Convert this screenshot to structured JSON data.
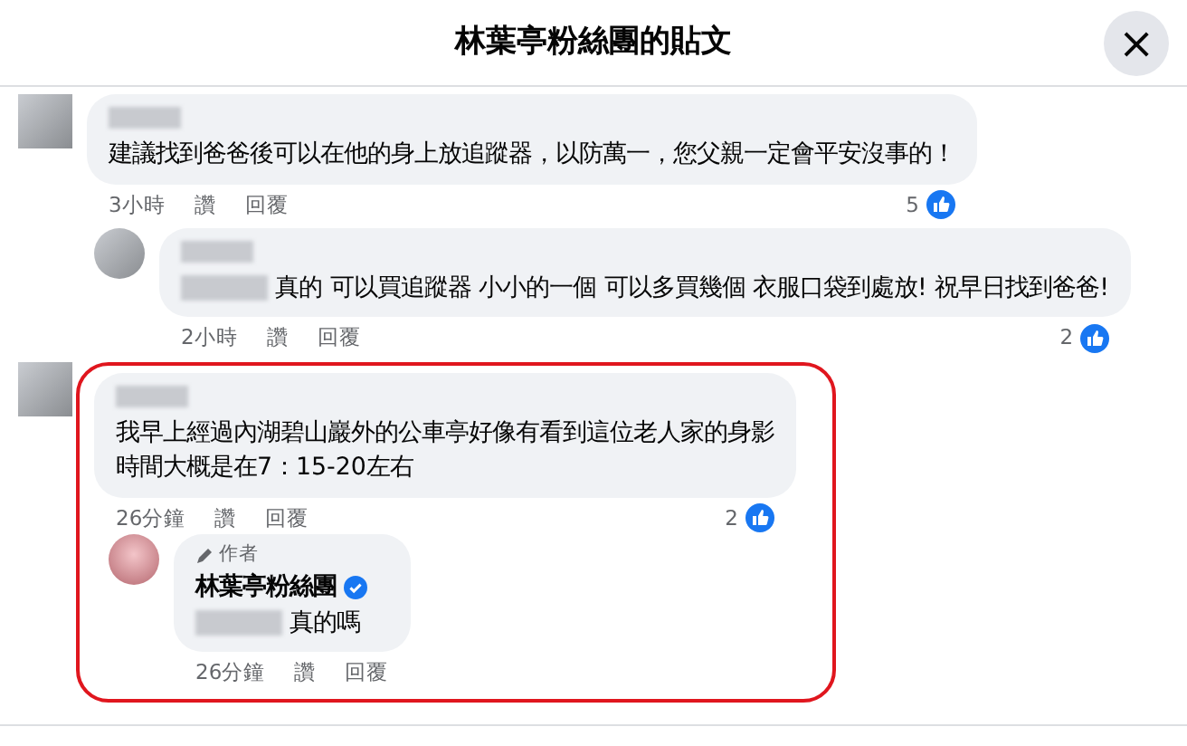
{
  "header": {
    "title": "林葉亭粉絲團的貼文",
    "close": "×"
  },
  "comments": [
    {
      "name_hidden": true,
      "text": "建議找到爸爸後可以在他的身上放追蹤器，以防萬一，您父親一定會平安沒事的！",
      "time": "3小時",
      "like": "讚",
      "reply": "回覆",
      "likes": "5",
      "highlighted": false,
      "children": [
        {
          "name_hidden": true,
          "mention_hidden": true,
          "text": "真的 可以買追蹤器 小小的一個 可以多買幾個 衣服口袋到處放! 祝早日找到爸爸!",
          "time": "2小時",
          "like": "讚",
          "reply": "回覆",
          "likes": "2"
        }
      ]
    },
    {
      "name_hidden": true,
      "text": [
        "我早上經過內湖碧山巖外的公車亭好像有看到這位老人家的身影",
        "時間大概是在7：15-20左右"
      ],
      "time": "26分鐘",
      "like": "讚",
      "reply": "回覆",
      "likes": "2",
      "highlighted": true,
      "children": [
        {
          "author_badge": "作者",
          "name": "林葉亭粉絲團",
          "verified": true,
          "mention_hidden": true,
          "text": "真的嗎",
          "time": "26分鐘",
          "like": "讚",
          "reply": "回覆"
        }
      ]
    }
  ]
}
